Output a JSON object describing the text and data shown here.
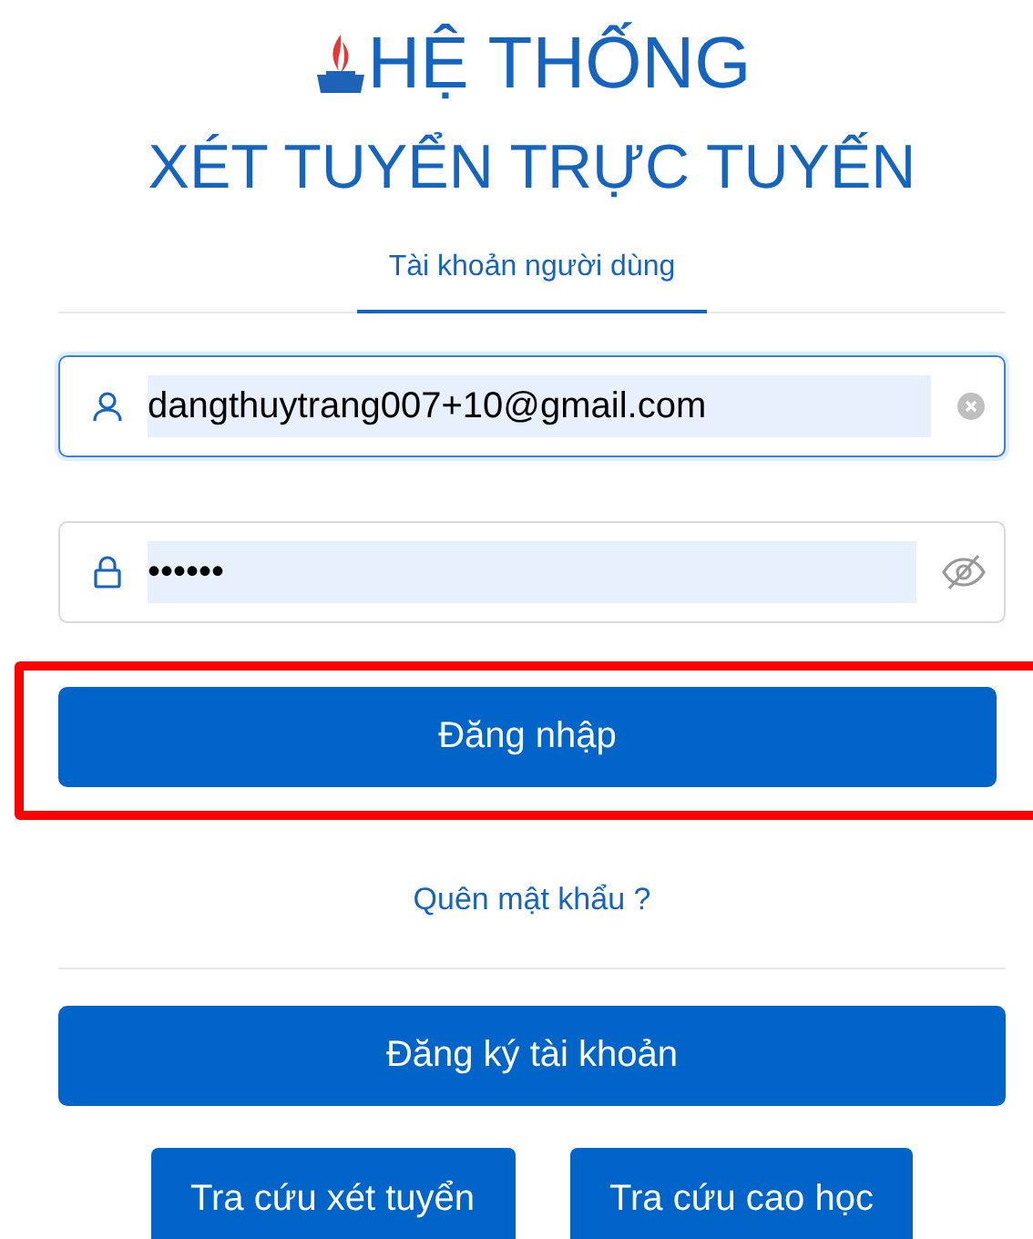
{
  "header": {
    "title_line_1": "HỆ THỐNG",
    "title_line_2": "XÉT TUYỂN TRỰC TUYẾN"
  },
  "tabs": [
    {
      "label": "Tài khoản người dùng",
      "selected": true
    }
  ],
  "fields": [
    {
      "kind": "username",
      "value": "dangthuytrang007+10@gmail.com",
      "focused": true
    },
    {
      "kind": "password",
      "value": "••••••",
      "focused": false
    }
  ],
  "login_button": {
    "label": "Đăng nhập",
    "highlighted": true
  },
  "forgot_link": "Quên mật khẩu ?",
  "register_button": "Đăng ký tài khoản",
  "lookup_buttons": [
    "Tra cứu xét tuyển",
    "Tra cứu cao học"
  ]
}
